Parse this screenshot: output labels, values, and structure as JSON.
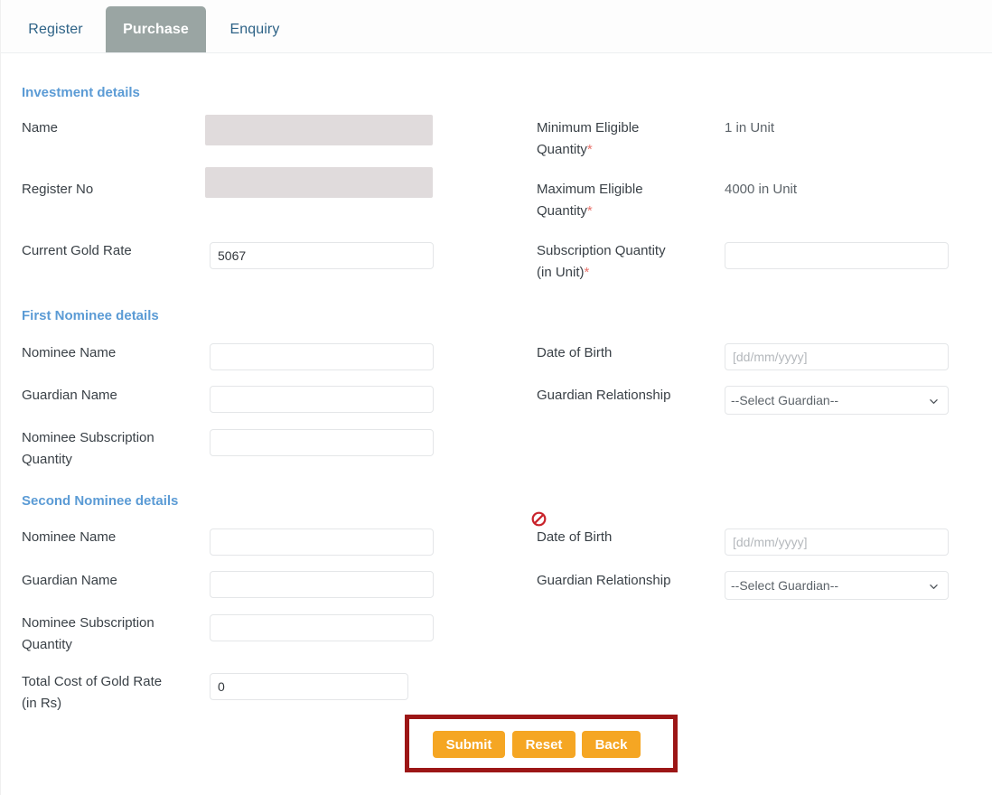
{
  "tabs": [
    {
      "label": "Register",
      "active": false
    },
    {
      "label": "Purchase",
      "active": true
    },
    {
      "label": "Enquiry",
      "active": false
    }
  ],
  "sections": {
    "investment": {
      "title": "Investment details",
      "name_label": "Name",
      "name_value": "",
      "register_no_label": "Register No",
      "register_no_value": "",
      "current_gold_rate_label": "Current Gold Rate",
      "current_gold_rate_value": "5067",
      "min_qty_label": "Minimum Eligible\nQuantity",
      "min_qty_value": "1 in Unit",
      "max_qty_label": "Maximum Eligible\nQuantity",
      "max_qty_value": "4000 in Unit",
      "subscription_qty_label": "Subscription Quantity\n(in Unit)",
      "subscription_qty_value": "",
      "required_marker": "*"
    },
    "first_nominee": {
      "title": "First Nominee details",
      "nominee_name_label": "Nominee Name",
      "nominee_name_value": "",
      "guardian_name_label": "Guardian Name",
      "guardian_name_value": "",
      "nominee_sub_qty_label": "Nominee Subscription\nQuantity",
      "nominee_sub_qty_value": "",
      "dob_label": "Date of Birth",
      "dob_value": "",
      "dob_placeholder": "[dd/mm/yyyy]",
      "guardian_rel_label": "Guardian Relationship",
      "guardian_rel_selected": "--Select Guardian--"
    },
    "second_nominee": {
      "title": "Second Nominee details",
      "nominee_name_label": "Nominee Name",
      "nominee_name_value": "",
      "guardian_name_label": "Guardian Name",
      "guardian_name_value": "",
      "nominee_sub_qty_label": "Nominee Subscription\nQuantity",
      "nominee_sub_qty_value": "",
      "dob_label": "Date of Birth",
      "dob_value": "",
      "dob_placeholder": "[dd/mm/yyyy]",
      "guardian_rel_label": "Guardian Relationship",
      "guardian_rel_selected": "--Select Guardian--"
    },
    "total": {
      "label": "Total Cost of Gold Rate\n(in Rs)",
      "value": "0"
    }
  },
  "guardian_options": [
    "--Select Guardian--"
  ],
  "buttons": {
    "submit": "Submit",
    "reset": "Reset",
    "back": "Back"
  },
  "icons": {
    "no_entry": "no-entry-cursor-icon",
    "chevron": "chevron-down-icon"
  },
  "colors": {
    "tab_active_bg": "#9aa5a3",
    "tab_inactive_text": "#2e6387",
    "section_heading": "#5b9bd5",
    "required_asterisk": "#e8736c",
    "button_orange": "#f5a623",
    "annotation_red": "#9c1616",
    "disabled_field": "#e0dbdc"
  }
}
